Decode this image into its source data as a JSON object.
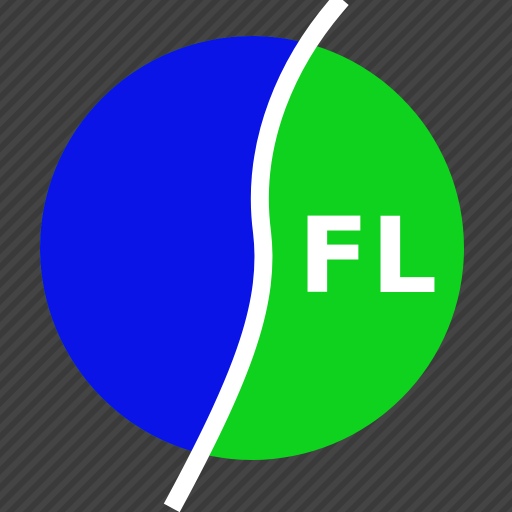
{
  "logo": {
    "text": "FL",
    "colors": {
      "background": "#3a3a3a",
      "background_stripe": "#444444",
      "left_half": "#0a14e6",
      "right_half": "#0fd21e",
      "divider": "#ffffff",
      "text": "#ffffff"
    },
    "icon": "app-logo-icon"
  }
}
